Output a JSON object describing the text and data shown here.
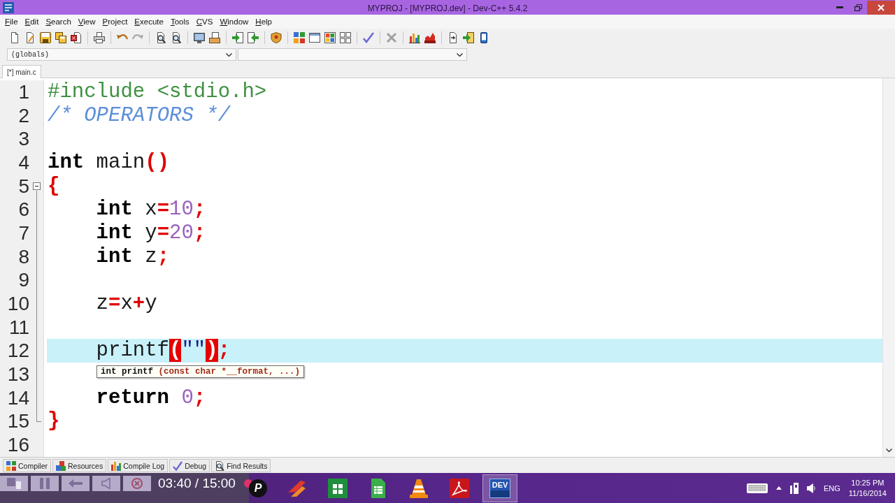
{
  "window": {
    "title": "MYPROJ - [MYPROJ.dev] - Dev-C++ 5.4.2"
  },
  "menu": [
    "File",
    "Edit",
    "Search",
    "View",
    "Project",
    "Execute",
    "Tools",
    "CVS",
    "Window",
    "Help"
  ],
  "scope_dropdown": {
    "value": "(globals)"
  },
  "editor_tabs": [
    {
      "label": "[*] main.c",
      "selected": true
    }
  ],
  "editor": {
    "lines": [
      {
        "number": "1",
        "current": false,
        "indented": false,
        "tokens": [
          {
            "kind": "preproc",
            "text": "#include <stdio.h>"
          }
        ]
      },
      {
        "number": "2",
        "current": false,
        "indented": false,
        "tokens": [
          {
            "kind": "comment",
            "text": "/* OPERATORS */"
          }
        ]
      },
      {
        "number": "3",
        "current": false
      },
      {
        "number": "4",
        "current": false,
        "indented": false,
        "tokens": [
          {
            "kind": "keyword",
            "text": "int"
          },
          {
            "kind": "plain",
            "text": " main"
          },
          {
            "kind": "symbol",
            "text": "()"
          }
        ]
      },
      {
        "number": "5",
        "current": false,
        "indented": false,
        "expanded": true,
        "tokens": [
          {
            "kind": "symbol",
            "text": "{"
          }
        ],
        "children": [
          {
            "number": "6",
            "current": false,
            "indented": true,
            "tokens": [
              {
                "kind": "keyword",
                "text": "int"
              },
              {
                "kind": "plain",
                "text": " x"
              },
              {
                "kind": "symbol",
                "text": "="
              },
              {
                "kind": "number",
                "text": "10"
              },
              {
                "kind": "symbol",
                "text": ";"
              }
            ]
          },
          {
            "number": "7",
            "current": false,
            "indented": true,
            "tokens": [
              {
                "kind": "keyword",
                "text": "int"
              },
              {
                "kind": "plain",
                "text": " y"
              },
              {
                "kind": "symbol",
                "text": "="
              },
              {
                "kind": "number",
                "text": "20"
              },
              {
                "kind": "symbol",
                "text": ";"
              }
            ]
          },
          {
            "number": "8",
            "current": false,
            "indented": true,
            "tokens": [
              {
                "kind": "keyword",
                "text": "int"
              },
              {
                "kind": "plain",
                "text": " z"
              },
              {
                "kind": "symbol",
                "text": ";"
              }
            ]
          },
          {
            "number": "9",
            "current": false
          },
          {
            "number": "10",
            "current": false,
            "indented": true,
            "tokens": [
              {
                "kind": "plain",
                "text": "z"
              },
              {
                "kind": "symbol",
                "text": "="
              },
              {
                "kind": "plain",
                "text": "x"
              },
              {
                "kind": "symbol",
                "text": "+"
              },
              {
                "kind": "plain",
                "text": "y"
              }
            ]
          },
          {
            "number": "11",
            "current": false
          },
          {
            "number": "12",
            "current": true,
            "indented": true,
            "tokens": [
              {
                "kind": "plain",
                "text": "printf"
              },
              {
                "kind": "match",
                "text": "("
              },
              {
                "kind": "string",
                "text": "\"\""
              },
              {
                "kind": "match",
                "text": ")"
              },
              {
                "kind": "symbol",
                "text": ";"
              }
            ]
          },
          {
            "number": "13",
            "current": false
          },
          {
            "number": "14",
            "current": false,
            "indented": true,
            "tokens": [
              {
                "kind": "keyword",
                "text": "return"
              },
              {
                "kind": "number",
                "text": " 0"
              },
              {
                "kind": "symbol",
                "text": ";"
              }
            ]
          },
          {
            "number": "15",
            "current": false,
            "indented": false,
            "tokens": [
              {
                "kind": "symbol",
                "text": "}"
              }
            ]
          }
        ]
      },
      {
        "number": "16",
        "current": false
      }
    ],
    "tooltip": {
      "name": "int printf",
      "params": "(const char *__format, ...)"
    }
  },
  "panel_tabs": [
    {
      "label": "Compiler",
      "selected": false
    },
    {
      "label": "Resources",
      "selected": false
    },
    {
      "label": "Compile Log",
      "selected": false
    },
    {
      "label": "Debug",
      "selected": false
    },
    {
      "label": "Find Results",
      "selected": false
    }
  ],
  "player": {
    "time": "03:40 / 15:00"
  },
  "taskbar": {
    "apps": [
      {
        "kind": "letter",
        "label": "P",
        "active": false
      },
      {
        "kind": "flame",
        "active": false
      },
      {
        "kind": "store",
        "active": false
      },
      {
        "kind": "sheet",
        "active": false
      },
      {
        "kind": "cone",
        "active": false
      },
      {
        "kind": "pdf",
        "active": false
      },
      {
        "kind": "tile",
        "label": "DEV",
        "active": true
      }
    ],
    "tray": {
      "language": "ENG",
      "time": "10:25 PM",
      "date": "11/16/2014"
    }
  }
}
